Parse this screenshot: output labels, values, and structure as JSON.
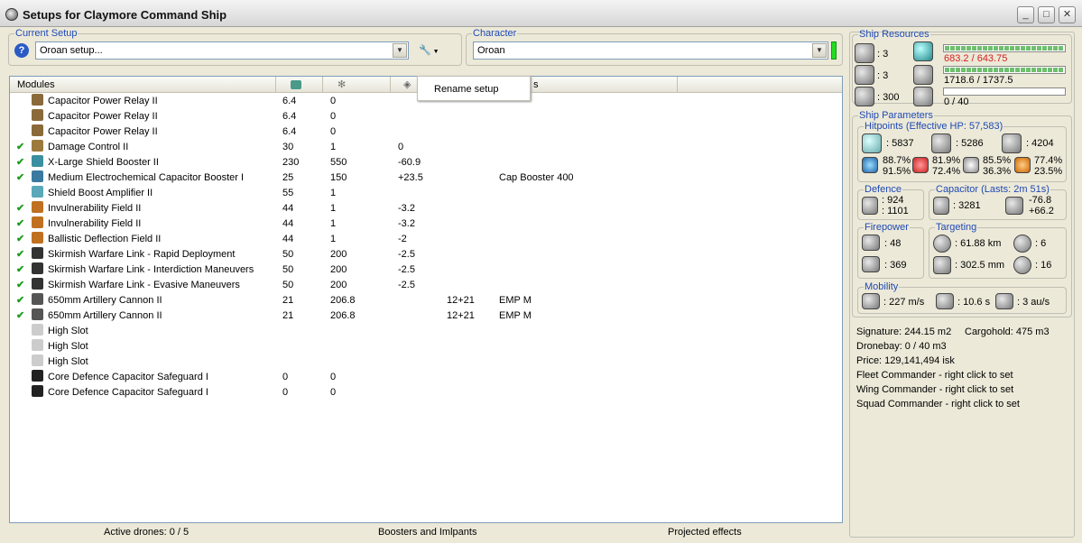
{
  "window": {
    "title": "Setups for Claymore Command Ship"
  },
  "current_setup": {
    "legend": "Current Setup",
    "value": "Oroan setup..."
  },
  "character": {
    "legend": "Character",
    "value": "Oroan"
  },
  "context_menu": {
    "item": "Rename setup"
  },
  "grid": {
    "headers": {
      "modules": "Modules",
      "extra": "s"
    },
    "rows": [
      {
        "check": false,
        "icon": "capacitor-relay-icon",
        "name": "Capacitor Power Relay II",
        "cpu": "6.4",
        "pg": "0",
        "c3": "",
        "c4": "",
        "c5": ""
      },
      {
        "check": false,
        "icon": "capacitor-relay-icon",
        "name": "Capacitor Power Relay II",
        "cpu": "6.4",
        "pg": "0",
        "c3": "",
        "c4": "",
        "c5": ""
      },
      {
        "check": false,
        "icon": "capacitor-relay-icon",
        "name": "Capacitor Power Relay II",
        "cpu": "6.4",
        "pg": "0",
        "c3": "",
        "c4": "",
        "c5": ""
      },
      {
        "check": true,
        "icon": "damage-control-icon",
        "name": "Damage Control II",
        "cpu": "30",
        "pg": "1",
        "c3": "0",
        "c4": "",
        "c5": ""
      },
      {
        "check": true,
        "icon": "shield-booster-icon",
        "name": "X-Large Shield Booster II",
        "cpu": "230",
        "pg": "550",
        "c3": "-60.9",
        "c4": "",
        "c5": ""
      },
      {
        "check": true,
        "icon": "cap-booster-icon",
        "name": "Medium Electrochemical Capacitor Booster I",
        "cpu": "25",
        "pg": "150",
        "c3": "+23.5",
        "c4": "",
        "c5": "Cap Booster 400"
      },
      {
        "check": false,
        "icon": "shield-amplifier-icon",
        "name": "Shield Boost Amplifier II",
        "cpu": "55",
        "pg": "1",
        "c3": "",
        "c4": "",
        "c5": ""
      },
      {
        "check": true,
        "icon": "hardener-icon",
        "name": "Invulnerability Field II",
        "cpu": "44",
        "pg": "1",
        "c3": "-3.2",
        "c4": "",
        "c5": ""
      },
      {
        "check": true,
        "icon": "hardener-icon",
        "name": "Invulnerability Field II",
        "cpu": "44",
        "pg": "1",
        "c3": "-3.2",
        "c4": "",
        "c5": ""
      },
      {
        "check": true,
        "icon": "hardener-icon",
        "name": "Ballistic Deflection Field II",
        "cpu": "44",
        "pg": "1",
        "c3": "-2",
        "c4": "",
        "c5": ""
      },
      {
        "check": true,
        "icon": "warfare-link-icon",
        "name": "Skirmish Warfare Link - Rapid Deployment",
        "cpu": "50",
        "pg": "200",
        "c3": "-2.5",
        "c4": "",
        "c5": ""
      },
      {
        "check": true,
        "icon": "warfare-link-icon",
        "name": "Skirmish Warfare Link - Interdiction Maneuvers",
        "cpu": "50",
        "pg": "200",
        "c3": "-2.5",
        "c4": "",
        "c5": ""
      },
      {
        "check": true,
        "icon": "warfare-link-icon",
        "name": "Skirmish Warfare Link - Evasive Maneuvers",
        "cpu": "50",
        "pg": "200",
        "c3": "-2.5",
        "c4": "",
        "c5": ""
      },
      {
        "check": true,
        "icon": "artillery-icon",
        "name": "650mm Artillery Cannon II",
        "cpu": "21",
        "pg": "206.8",
        "c3": "",
        "c4": "12+21",
        "c5": "EMP M"
      },
      {
        "check": true,
        "icon": "artillery-icon",
        "name": "650mm Artillery Cannon II",
        "cpu": "21",
        "pg": "206.8",
        "c3": "",
        "c4": "12+21",
        "c5": "EMP M"
      },
      {
        "check": false,
        "icon": "empty-slot-icon",
        "name": "High Slot",
        "cpu": "",
        "pg": "",
        "c3": "",
        "c4": "",
        "c5": ""
      },
      {
        "check": false,
        "icon": "empty-slot-icon",
        "name": "High Slot",
        "cpu": "",
        "pg": "",
        "c3": "",
        "c4": "",
        "c5": ""
      },
      {
        "check": false,
        "icon": "empty-slot-icon",
        "name": "High Slot",
        "cpu": "",
        "pg": "",
        "c3": "",
        "c4": "",
        "c5": ""
      },
      {
        "check": false,
        "icon": "rig-icon",
        "name": "Core Defence Capacitor Safeguard I",
        "cpu": "0",
        "pg": "0",
        "c3": "",
        "c4": "",
        "c5": ""
      },
      {
        "check": false,
        "icon": "rig-icon",
        "name": "Core Defence Capacitor Safeguard I",
        "cpu": "0",
        "pg": "0",
        "c3": "",
        "c4": "",
        "c5": ""
      }
    ]
  },
  "status": {
    "drones": "Active drones: 0 / 5",
    "boosters": "Boosters and Imlpants",
    "projected": "Projected effects"
  },
  "resources": {
    "legend": "Ship Resources",
    "turret_slots": ": 3",
    "launcher_slots": ": 3",
    "calibration": ": 300",
    "cpu": "683.2 / 643.75",
    "cpu_fraction": 1.0,
    "powergrid": "1718.6 / 1737.5",
    "powergrid_fraction": 0.99,
    "drone_bandwidth": "0 / 40",
    "drone_fraction": 0.0
  },
  "params": {
    "legend": "Ship Parameters",
    "hitpoints": {
      "legend": "Hitpoints (Effective HP: 57,583)",
      "shield": ": 5837",
      "armor": ": 5286",
      "structure": ": 4204",
      "em_a": "88.7%",
      "em_b": "91.5%",
      "th_a": "81.9%",
      "th_b": "72.4%",
      "ki_a": "85.5%",
      "ki_b": "36.3%",
      "ex_a": "77.4%",
      "ex_b": "23.5%"
    },
    "defence": {
      "legend": "Defence",
      "a": ": 924",
      "b": ": 1101"
    },
    "capacitor": {
      "legend": "Capacitor (Lasts: 2m 51s)",
      "amount": ": 3281",
      "a": "-76.8",
      "b": "+66.2"
    },
    "firepower": {
      "legend": "Firepower",
      "a": ": 48",
      "b": ": 369"
    },
    "targeting": {
      "legend": "Targeting",
      "range": ": 61.88 km",
      "targets": ": 6",
      "scan": ": 302.5 mm",
      "sensor": ": 16"
    },
    "mobility": {
      "legend": "Mobility",
      "speed": ": 227 m/s",
      "align": ": 10.6 s",
      "warp": ": 3 au/s"
    }
  },
  "info": {
    "signature": "Signature: 244.15 m2",
    "cargohold": "Cargohold: 475 m3",
    "dronebay": "Dronebay: 0 / 40 m3",
    "price": "Price: 129,141,494 isk",
    "fleet": "Fleet Commander - right click to set",
    "wing": "Wing Commander - right click to set",
    "squad": "Squad Commander - right click to set"
  }
}
